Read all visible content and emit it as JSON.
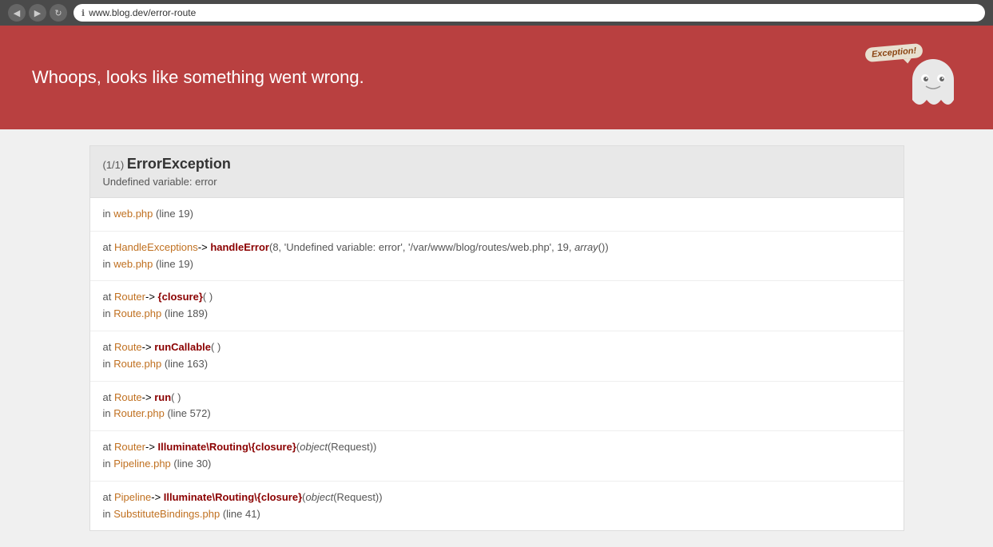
{
  "browser": {
    "url": "www.blog.dev/error-route",
    "back_button": "◀",
    "forward_button": "▶",
    "reload_button": "↻"
  },
  "banner": {
    "message": "Whoops, looks like something went wrong.",
    "mascot_text": "Exception!"
  },
  "exception": {
    "counter": "(1/1)",
    "type": "ErrorException",
    "message": "Undefined variable: error",
    "stack_trace": [
      {
        "id": 1,
        "location_prefix": "in",
        "file": "web.php",
        "line": "(line 19)"
      },
      {
        "id": 2,
        "at_prefix": "at",
        "class": "HandleExceptions",
        "arrow": "->",
        "method": "handleError",
        "args": "(8, 'Undefined variable: error', '/var/www/blog/routes/web.php', 19, array())",
        "location_prefix": "in",
        "file": "web.php",
        "line": "(line 19)"
      },
      {
        "id": 3,
        "at_prefix": "at",
        "class": "Router",
        "arrow": "->",
        "method": "{closure}",
        "args": "()",
        "location_prefix": "in",
        "file": "Route.php",
        "line": "(line 189)"
      },
      {
        "id": 4,
        "at_prefix": "at",
        "class": "Route",
        "arrow": "->",
        "method": "runCallable",
        "args": "()",
        "location_prefix": "in",
        "file": "Route.php",
        "line": "(line 163)"
      },
      {
        "id": 5,
        "at_prefix": "at",
        "class": "Route",
        "arrow": "->",
        "method": "run",
        "args": "()",
        "location_prefix": "in",
        "file": "Router.php",
        "line": "(line 572)"
      },
      {
        "id": 6,
        "at_prefix": "at",
        "class": "Router",
        "arrow": "->",
        "method": "Illuminate\\Routing\\{closure}",
        "args_prefix": "(",
        "arg_keyword": "object",
        "arg_value": "(Request)",
        "args_suffix": ")",
        "location_prefix": "in",
        "file": "Pipeline.php",
        "line": "(line 30)"
      },
      {
        "id": 7,
        "at_prefix": "at",
        "class": "Pipeline",
        "arrow": "->",
        "method": "Illuminate\\Routing\\{closure}",
        "args_prefix": "(",
        "arg_keyword": "object",
        "arg_value": "(Request)",
        "args_suffix": ")",
        "location_prefix": "in",
        "file": "SubstituteBindings.php",
        "line": "(line 41)"
      }
    ]
  }
}
